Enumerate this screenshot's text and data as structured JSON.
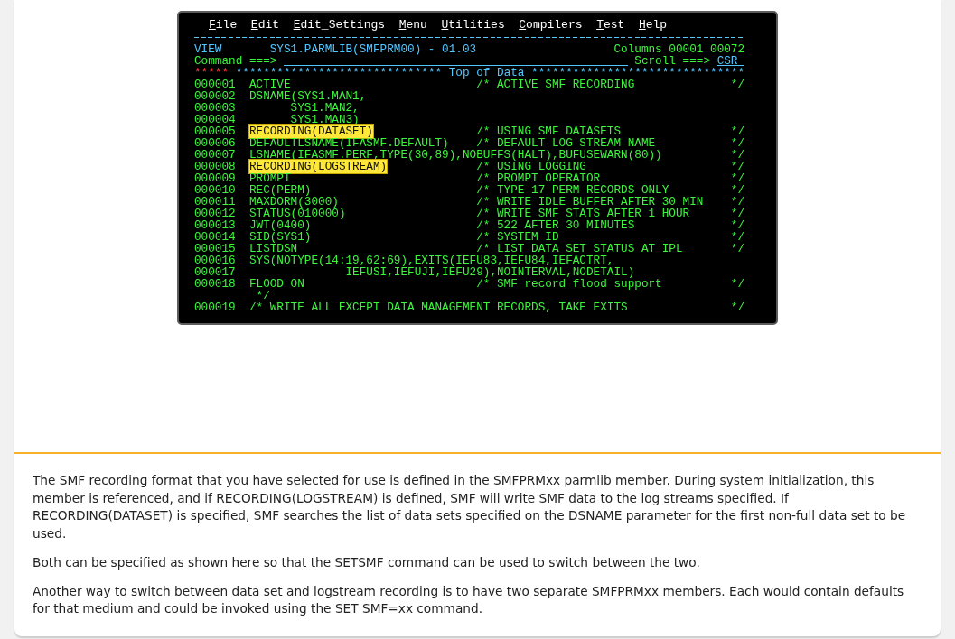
{
  "terminal": {
    "menu": [
      {
        "label": "File"
      },
      {
        "label": "Edit"
      },
      {
        "label": "Edit_Settings"
      },
      {
        "label": "Menu"
      },
      {
        "label": "Utilities"
      },
      {
        "label": "Compilers"
      },
      {
        "label": "Test"
      },
      {
        "label": "Help"
      }
    ],
    "header": {
      "mode": "VIEW",
      "dataset": "SYS1.PARMLIB(SMFPRM00) - 01.03",
      "columns": "Columns 00001 00072",
      "command_label": "Command ===>",
      "scroll_label": "Scroll ===>",
      "scroll_value": "CSR"
    },
    "top_marker": {
      "left": "***** ******************************",
      "label": "Top of Data",
      "right": "*******************************"
    },
    "lines": [
      {
        "number": "000001",
        "code": "ACTIVE",
        "highlighted": false,
        "comment": "/* ACTIVE SMF RECORDING",
        "end": "*/"
      },
      {
        "number": "000002",
        "code": "DSNAME(SYS1.MAN1,",
        "highlighted": false
      },
      {
        "number": "000003",
        "code": "      SYS1.MAN2,",
        "highlighted": false
      },
      {
        "number": "000004",
        "code": "      SYS1.MAN3)",
        "highlighted": false
      },
      {
        "number": "000005",
        "code": "RECORDING(DATASET)",
        "highlighted": true,
        "comment": "/* USING SMF DATASETS",
        "end": "*/"
      },
      {
        "number": "000006",
        "code": "DEFAULTLSNAME(IFASMF.DEFAULT)",
        "highlighted": false,
        "comment": "/* DEFAULT LOG STREAM NAME",
        "end": "*/"
      },
      {
        "number": "000007",
        "code": "LSNAME(IFASMF.PERF,TYPE(30,89),NOBUFFS(HALT),BUFUSEWARN(80))",
        "highlighted": false,
        "end": "*/"
      },
      {
        "number": "000008",
        "code": "RECORDING(LOGSTREAM)",
        "highlighted": true,
        "comment": "/* USING LOGGING",
        "end": "*/"
      },
      {
        "number": "000009",
        "code": "PROMPT",
        "highlighted": false,
        "comment": "/* PROMPT OPERATOR",
        "end": "*/"
      },
      {
        "number": "000010",
        "code": "REC(PERM)",
        "highlighted": false,
        "comment": "/* TYPE 17 PERM RECORDS ONLY",
        "end": "*/"
      },
      {
        "number": "000011",
        "code": "MAXDORM(3000)",
        "highlighted": false,
        "comment": "/* WRITE IDLE BUFFER AFTER 30 MIN",
        "end": "*/"
      },
      {
        "number": "000012",
        "code": "STATUS(010000)",
        "highlighted": false,
        "comment": "/* WRITE SMF STATS AFTER 1 HOUR",
        "end": "*/"
      },
      {
        "number": "000013",
        "code": "JWT(0400)",
        "highlighted": false,
        "comment": "/* 522 AFTER 30 MINUTES",
        "end": "*/"
      },
      {
        "number": "000014",
        "code": "SID(SYS1)",
        "highlighted": false,
        "comment": "/* SYSTEM ID",
        "end": "*/"
      },
      {
        "number": "000015",
        "code": "LISTDSN",
        "highlighted": false,
        "comment": "/* LIST DATA SET STATUS AT IPL",
        "end": "*/"
      },
      {
        "number": "000016",
        "code": "SYS(NOTYPE(14:19,62:69),EXITS(IEFU83,IEFU84,IEFACTRT,",
        "highlighted": false
      },
      {
        "number": "000017",
        "code": "              IEFUSI,IEFUJI,IEFU29),NOINTERVAL,NODETAIL)",
        "highlighted": false
      },
      {
        "number": "000018",
        "code": "FLOOD ON",
        "highlighted": false,
        "comment": "/* SMF record flood support",
        "end": "*/"
      },
      {
        "code": " */",
        "highlighted": false
      },
      {
        "number": "000019",
        "code": "/* WRITE ALL EXCEPT DATA MANAGEMENT RECORDS, TAKE EXITS",
        "highlighted": false,
        "end": "*/"
      }
    ]
  },
  "paragraphs": [
    "The SMF recording format that you have selected for use is defined in the SMFPRMxx parmlib member. During system initialization, this member is referenced, and if RECORDING(LOGSTREAM) is defined, SMF will write SMF data to the log streams specified. If RECORDING(DATASET) is specified, SMF searches the list of data sets specified on the DSNAME parameter for the first non-full data set to be used.",
    "Both can be specified as shown here so that the SETSMF command can be used to switch between the two.",
    "Another way to switch between data set and logstream recording is to have two separate SMFPRMxx members. Each would contain defaults for that medium and could be invoked using the SET SMF=xx command."
  ]
}
